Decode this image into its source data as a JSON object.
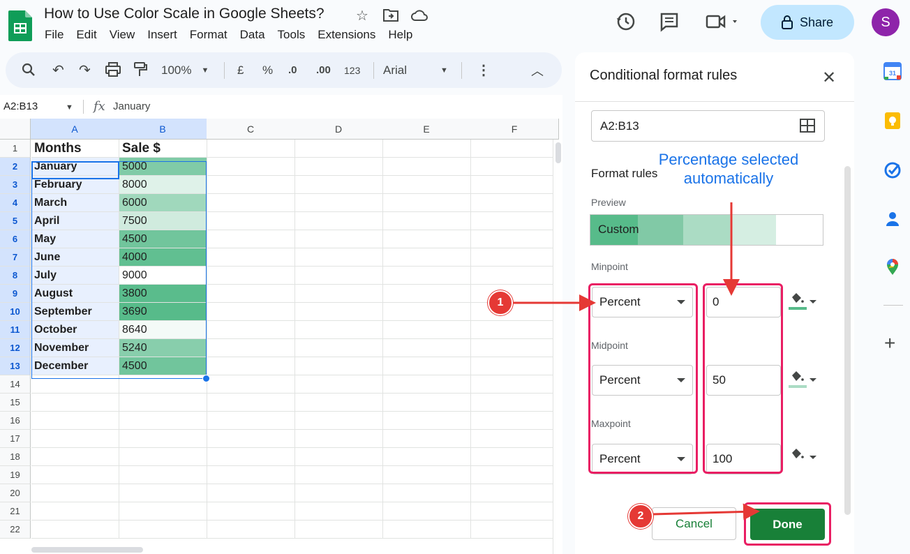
{
  "app": {
    "title": "How to Use Color Scale in Google Sheets?",
    "menu": [
      "File",
      "Edit",
      "View",
      "Insert",
      "Format",
      "Data",
      "Tools",
      "Extensions",
      "Help"
    ],
    "share_label": "Share",
    "avatar_initial": "S"
  },
  "toolbar": {
    "zoom": "100%",
    "currency": "£",
    "percent": "%",
    "dec_decrease": ".0",
    "dec_increase": ".00",
    "number_format": "123",
    "font": "Arial"
  },
  "formula_bar": {
    "name_box": "A2:B13",
    "fx": "fx",
    "content": "January"
  },
  "sheet": {
    "columns": [
      "A",
      "B",
      "C",
      "D",
      "E",
      "F"
    ],
    "rows": [
      {
        "num": "1",
        "a": "Months",
        "b": "Sale $"
      },
      {
        "num": "2",
        "a": "January",
        "b": "5000"
      },
      {
        "num": "3",
        "a": "February",
        "b": "8000"
      },
      {
        "num": "4",
        "a": "March",
        "b": "6000"
      },
      {
        "num": "5",
        "a": "April",
        "b": "7500"
      },
      {
        "num": "6",
        "a": "May",
        "b": "4500"
      },
      {
        "num": "7",
        "a": "June",
        "b": "4000"
      },
      {
        "num": "8",
        "a": "July",
        "b": "9000"
      },
      {
        "num": "9",
        "a": "August",
        "b": "3800"
      },
      {
        "num": "10",
        "a": "September",
        "b": "3690"
      },
      {
        "num": "11",
        "a": "October",
        "b": "8640"
      },
      {
        "num": "12",
        "a": "November",
        "b": "5240"
      },
      {
        "num": "13",
        "a": "December",
        "b": "4500"
      },
      {
        "num": "14",
        "a": "",
        "b": ""
      },
      {
        "num": "15",
        "a": "",
        "b": ""
      },
      {
        "num": "16",
        "a": "",
        "b": ""
      },
      {
        "num": "17",
        "a": "",
        "b": ""
      },
      {
        "num": "18",
        "a": "",
        "b": ""
      },
      {
        "num": "19",
        "a": "",
        "b": ""
      },
      {
        "num": "20",
        "a": "",
        "b": ""
      },
      {
        "num": "21",
        "a": "",
        "b": ""
      },
      {
        "num": "22",
        "a": "",
        "b": ""
      }
    ],
    "scale_colors": {
      "min": "#57bb8a",
      "mid": "#abdcc4",
      "max": "#ffffff"
    }
  },
  "panel": {
    "title": "Conditional format rules",
    "range": "A2:B13",
    "format_rules_label": "Format rules",
    "preview_label": "Preview",
    "preview_text": "Custom",
    "points": [
      {
        "label": "Minpoint",
        "type": "Percent",
        "value": "0",
        "color": "#57bb8a"
      },
      {
        "label": "Midpoint",
        "type": "Percent",
        "value": "50",
        "color": "#abdcc4"
      },
      {
        "label": "Maxpoint",
        "type": "Percent",
        "value": "100",
        "color": "#ffffff"
      }
    ],
    "cancel_label": "Cancel",
    "done_label": "Done"
  },
  "annotation": {
    "text_line1": "Percentage selected",
    "text_line2": "automatically",
    "badge1": "1",
    "badge2": "2",
    "color": "#e53935"
  },
  "rail": {
    "calendar_day": "31"
  }
}
